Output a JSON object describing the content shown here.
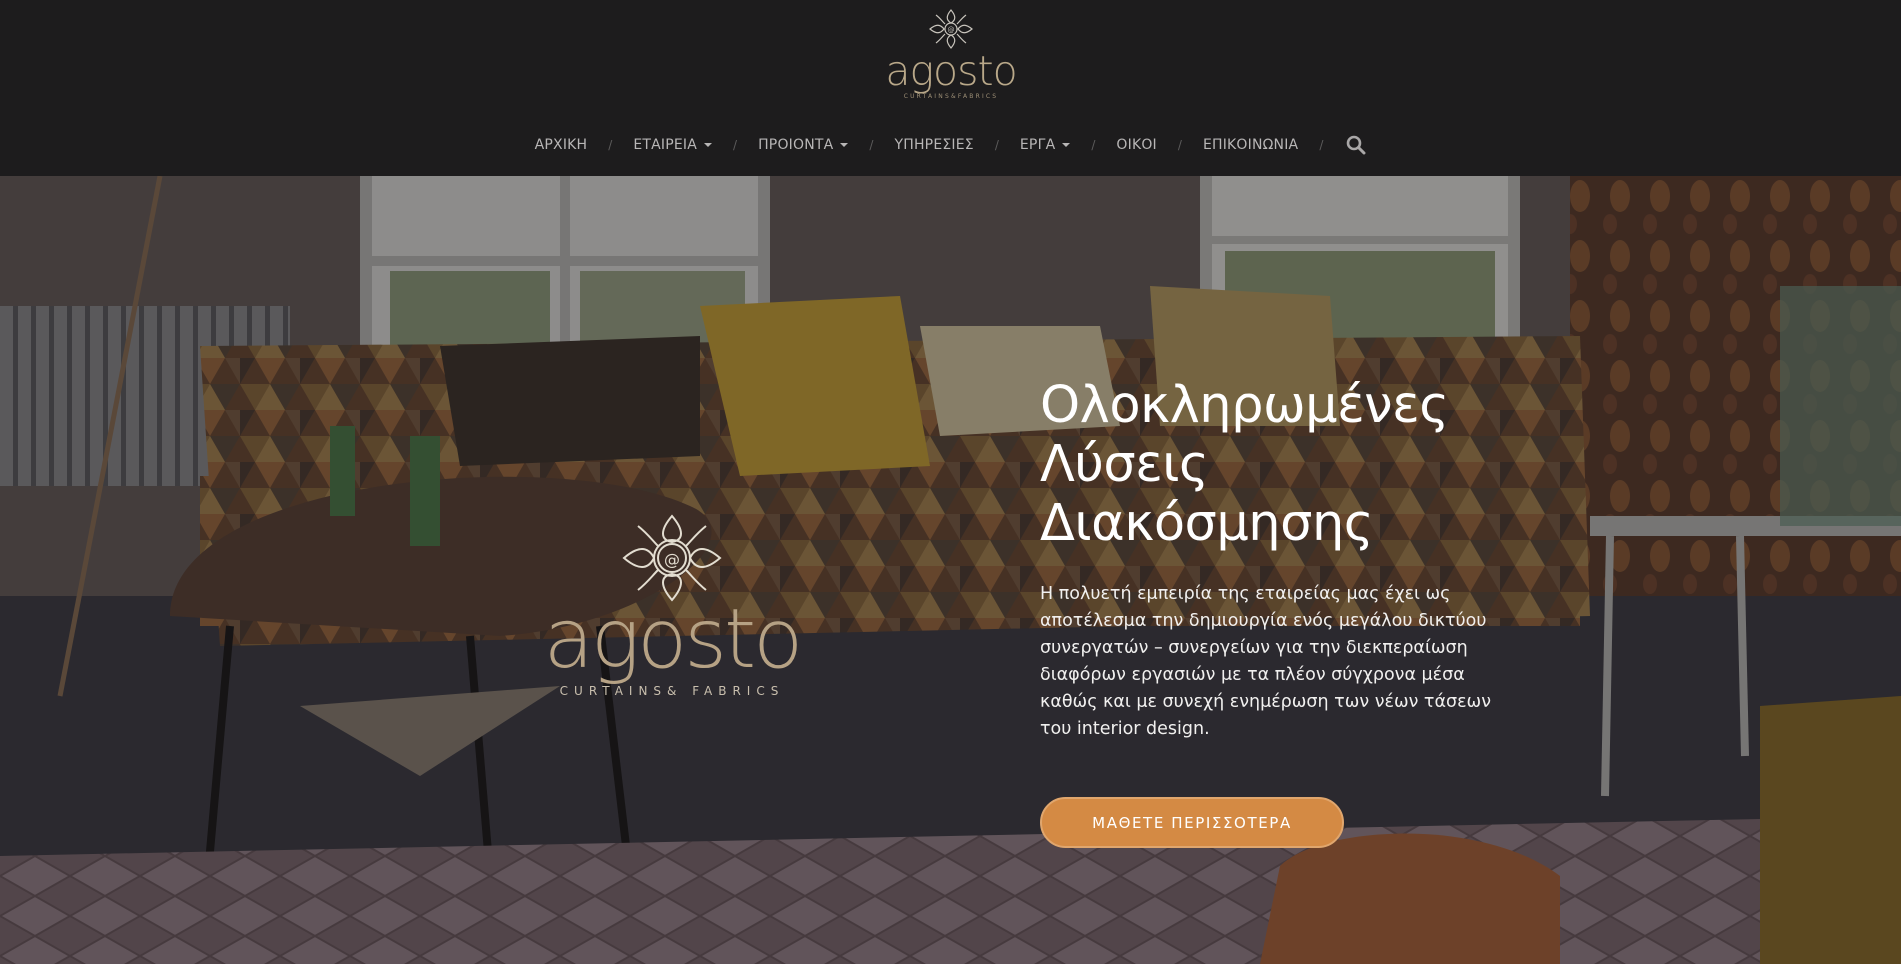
{
  "brand": {
    "name": "agosto",
    "tagline": "CURTAINS&FABRICS",
    "hero_tagline": "CURTAINS& FABRICS",
    "color": "#b9a889"
  },
  "nav": {
    "items": [
      {
        "label": "ΑΡΧΙΚΗ",
        "dropdown": false
      },
      {
        "label": "ΕΤΑΙΡΕΙΑ",
        "dropdown": true
      },
      {
        "label": "ΠΡΟΙΟΝΤΑ",
        "dropdown": true
      },
      {
        "label": "ΥΠΗΡΕΣΙΕΣ",
        "dropdown": false
      },
      {
        "label": "ΕΡΓΑ",
        "dropdown": true
      },
      {
        "label": "ΟΙΚΟΙ",
        "dropdown": false
      },
      {
        "label": "ΕΠΙΚΟΙΝΩΝΙΑ",
        "dropdown": false
      }
    ],
    "separator": "/",
    "search_icon": "search-icon"
  },
  "hero": {
    "title_lines": [
      "Ολοκληρωμένες",
      "Λύσεις",
      "Διακόσμησης"
    ],
    "description": "Η πολυετή εμπειρία της εταιρείας μας έχει ως αποτέλεσμα την δημιουργία ενός μεγάλου δικτύου συνεργατών – συνεργείων για την διεκπεραίωση διαφόρων εργασιών με τα πλέον σύγχρονα μέσα καθώς και με συνεχή ενημέρωση των νέων τάσεων του interior design.",
    "cta_label": "ΜΑΘΕΤΕ ΠΕΡΙΣΣΟΤΕΡΑ",
    "cta_color": "#d48a44"
  }
}
